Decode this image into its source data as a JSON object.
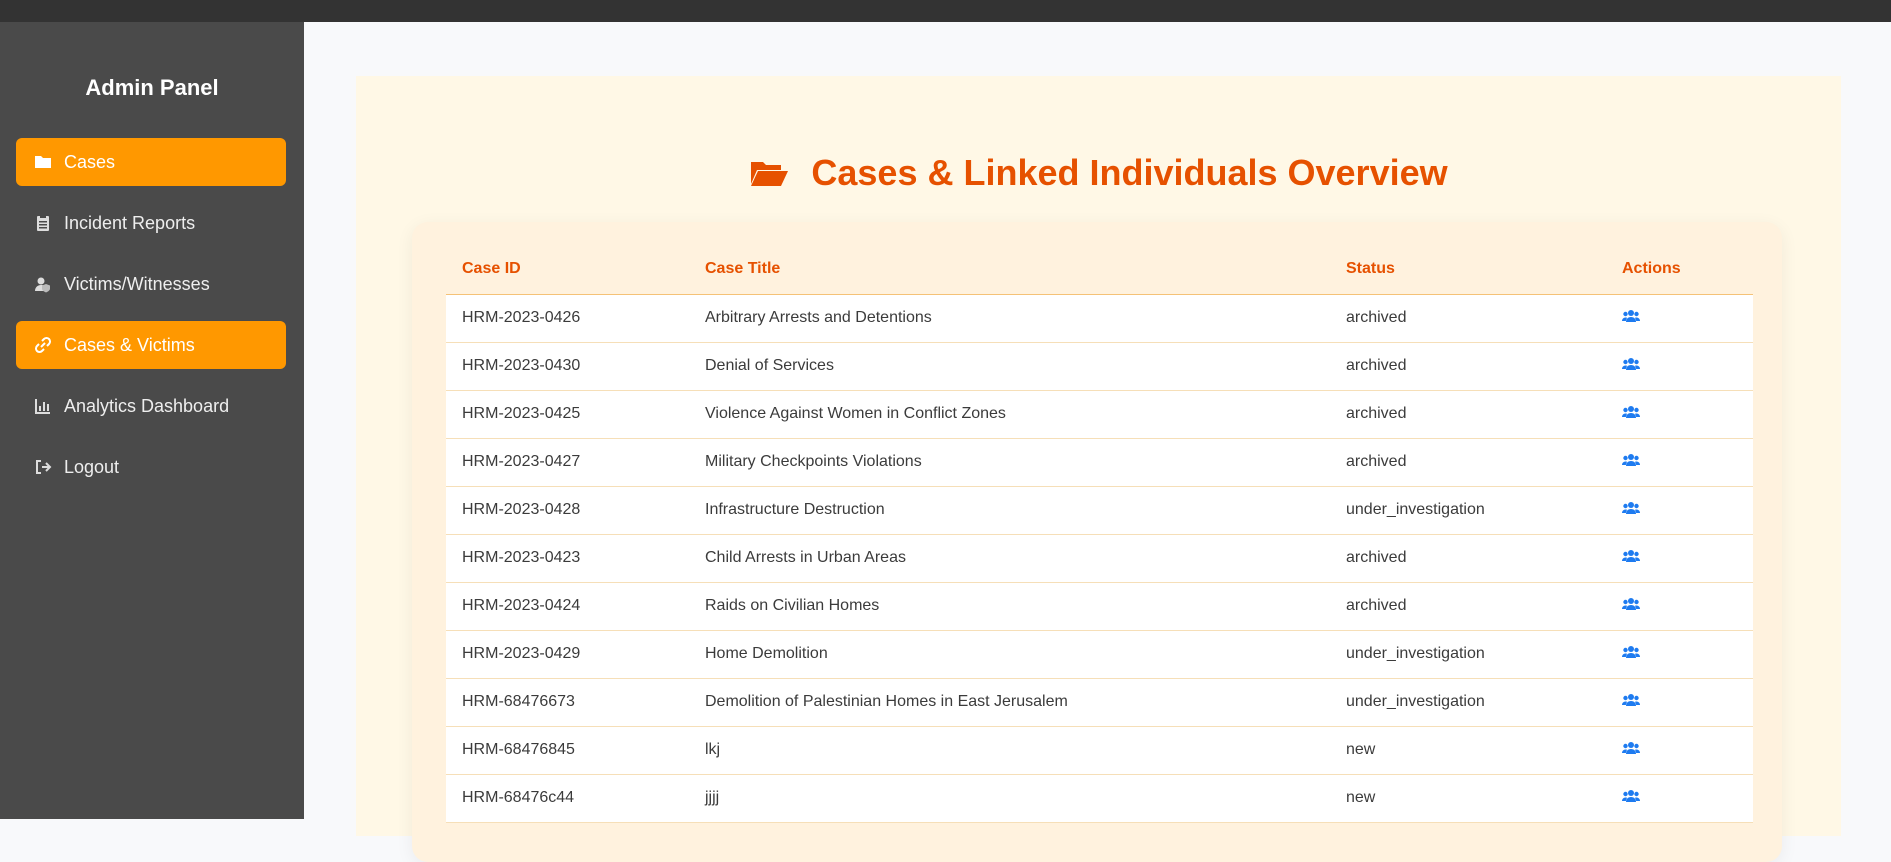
{
  "sidebar": {
    "title": "Admin Panel",
    "items": [
      {
        "label": "Cases",
        "icon": "folder-icon",
        "active": true
      },
      {
        "label": "Incident Reports",
        "icon": "clipboard-icon",
        "active": false
      },
      {
        "label": "Victims/Witnesses",
        "icon": "user-shield-icon",
        "active": false
      },
      {
        "label": "Cases & Victims",
        "icon": "link-icon",
        "active": true
      },
      {
        "label": "Analytics Dashboard",
        "icon": "chart-icon",
        "active": false
      },
      {
        "label": "Logout",
        "icon": "logout-icon",
        "active": false
      }
    ]
  },
  "main": {
    "title": "Cases & Linked Individuals Overview",
    "title_icon": "folder-open-icon",
    "table": {
      "headers": [
        "Case ID",
        "Case Title",
        "Status",
        "Actions"
      ],
      "rows": [
        {
          "id": "HRM-2023-0426",
          "title": "Arbitrary Arrests and Detentions",
          "status": "archived"
        },
        {
          "id": "HRM-2023-0430",
          "title": "Denial of Services",
          "status": "archived"
        },
        {
          "id": "HRM-2023-0425",
          "title": "Violence Against Women in Conflict Zones",
          "status": "archived"
        },
        {
          "id": "HRM-2023-0427",
          "title": "Military Checkpoints Violations",
          "status": "archived"
        },
        {
          "id": "HRM-2023-0428",
          "title": "Infrastructure Destruction",
          "status": "under_investigation"
        },
        {
          "id": "HRM-2023-0423",
          "title": "Child Arrests in Urban Areas",
          "status": "archived"
        },
        {
          "id": "HRM-2023-0424",
          "title": "Raids on Civilian Homes",
          "status": "archived"
        },
        {
          "id": "HRM-2023-0429",
          "title": "Home Demolition",
          "status": "under_investigation"
        },
        {
          "id": "HRM-68476673",
          "title": "Demolition of Palestinian Homes in East Jerusalem",
          "status": "under_investigation"
        },
        {
          "id": "HRM-68476845",
          "title": "lkj",
          "status": "new"
        },
        {
          "id": "HRM-68476c44",
          "title": "jjjj",
          "status": "new"
        }
      ],
      "action_icon": "users-icon"
    }
  },
  "colors": {
    "topbar": "#333333",
    "sidebar": "#4a4a4a",
    "accent": "#ff9800",
    "title": "#e65100",
    "action_icon": "#1e7bf0",
    "card": "#fff8e6"
  }
}
